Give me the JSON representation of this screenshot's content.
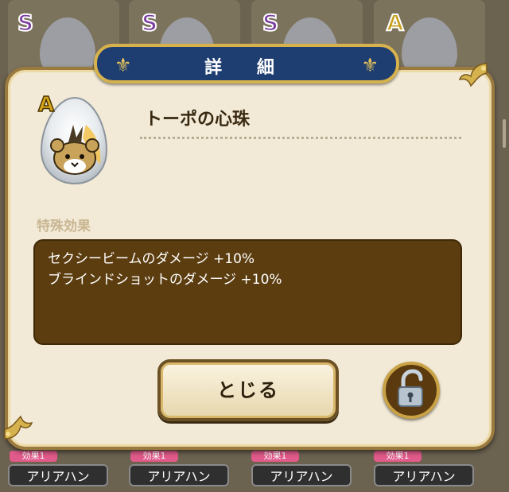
{
  "dialog": {
    "title": "詳 細",
    "item_rank": "A",
    "item_name": "トーポの心珠",
    "section_label": "特殊効果",
    "effects": [
      "セクシービームのダメージ +10%",
      "ブラインドショットのダメージ +10%"
    ],
    "close_label": "とじる",
    "lock_icon": "unlocked-padlock-icon"
  },
  "background": {
    "ranks": [
      "S",
      "S",
      "S",
      "A"
    ],
    "tags": [
      "効果1",
      "効果1",
      "効果1",
      "効果1"
    ],
    "names": [
      "アリアハン",
      "アリアハン",
      "アリアハン",
      "アリアハン"
    ]
  },
  "colors": {
    "title_bar": "#1e3d70",
    "gold_trim": "#d6b24e",
    "effect_box": "#5c3d10",
    "dialog_bg": "#f2ead7"
  }
}
